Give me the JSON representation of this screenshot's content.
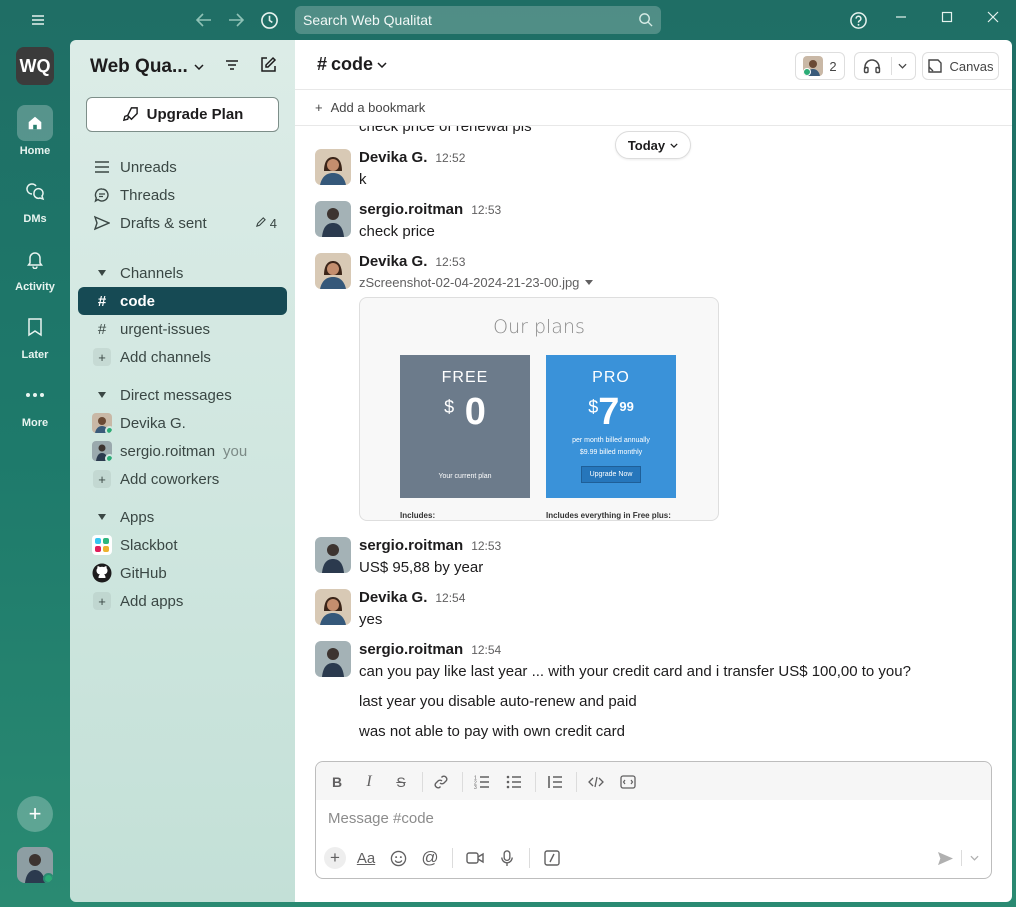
{
  "titlebar": {
    "search_placeholder": "Search Web Qualitat"
  },
  "rail": {
    "workspace_initials": "WQ",
    "items": [
      {
        "label": "Home",
        "icon": "home-icon"
      },
      {
        "label": "DMs",
        "icon": "dms-icon"
      },
      {
        "label": "Activity",
        "icon": "bell-icon"
      },
      {
        "label": "Later",
        "icon": "bookmark-icon"
      },
      {
        "label": "More",
        "icon": "more-icon"
      }
    ]
  },
  "sidebar": {
    "workspace_name": "Web Qua...",
    "upgrade_label": "Upgrade Plan",
    "nav": [
      {
        "label": "Unreads"
      },
      {
        "label": "Threads"
      },
      {
        "label": "Drafts & sent",
        "count": "4"
      }
    ],
    "channels_header": "Channels",
    "channels": [
      "code",
      "urgent-issues"
    ],
    "add_channels": "Add channels",
    "dm_header": "Direct messages",
    "dms": [
      {
        "name": "Devika G.",
        "suffix": ""
      },
      {
        "name": "sergio.roitman",
        "suffix": "you"
      }
    ],
    "add_coworkers": "Add coworkers",
    "apps_header": "Apps",
    "apps": [
      "Slackbot",
      "GitHub"
    ],
    "add_apps": "Add apps"
  },
  "channel": {
    "name": "code",
    "member_count": "2",
    "canvas_label": "Canvas",
    "bookmark_label": "Add a bookmark",
    "today_label": "Today"
  },
  "messages": {
    "partial_top": "check price of renewal pls",
    "list": [
      {
        "author": "Devika G.",
        "time": "12:52",
        "lines": [
          "k"
        ]
      },
      {
        "author": "sergio.roitman",
        "time": "12:53",
        "lines": [
          "check price"
        ]
      },
      {
        "author": "Devika G.",
        "time": "12:53",
        "file": "zScreenshot-02-04-2024-21-23-00.jpg"
      },
      {
        "author": "sergio.roitman",
        "time": "12:53",
        "lines": [
          "US$ 95,88 by year"
        ]
      },
      {
        "author": "Devika G.",
        "time": "12:54",
        "lines": [
          "yes"
        ]
      },
      {
        "author": "sergio.roitman",
        "time": "12:54",
        "lines": [
          "can you pay like last year ... with your credit card and i transfer US$ 100,00 to you?",
          "last year you disable auto-renew and paid",
          "was not able to pay with own credit card"
        ]
      }
    ]
  },
  "preview": {
    "title": "Our plans",
    "free": {
      "name": "FREE",
      "currency": "$",
      "price": "0",
      "note": "Your current plan",
      "includes": "Includes:"
    },
    "pro": {
      "name": "PRO",
      "currency": "$",
      "price": "7",
      "cents": "99",
      "sub1": "per month billed annually",
      "sub2": "$9.99 billed monthly",
      "button": "Upgrade Now",
      "includes": "Includes everything in Free plus:"
    }
  },
  "composer": {
    "placeholder": "Message #code"
  },
  "colors": {
    "active_channel": "#164a54",
    "online": "#2bac76",
    "pro_plan": "#3a92d9",
    "free_plan": "#6c7b8b"
  }
}
